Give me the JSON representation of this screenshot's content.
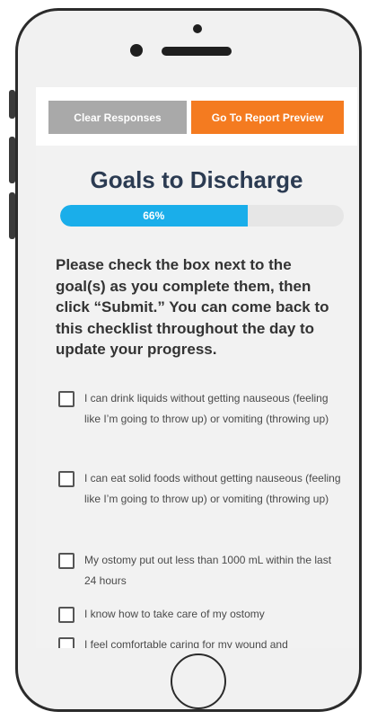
{
  "toolbar": {
    "clear_label": "Clear Responses",
    "report_label": "Go To Report Preview"
  },
  "page": {
    "title": "Goals to Discharge",
    "progress_text": "66%",
    "progress_fraction": 0.66,
    "instructions": "Please check the box next to the goal(s) as you complete them, then click “Submit.” You can come back to this checklist throughout the day to update your progress."
  },
  "goals": [
    {
      "label": "I can drink liquids without getting nauseous (feeling like I’m going to throw up) or vomiting (throwing up)",
      "checked": false
    },
    {
      "label": "I can eat solid foods without getting nauseous (feeling like I’m going to throw up) or vomiting (throwing up)",
      "checked": false
    },
    {
      "label": "My ostomy put out less than 1000 mL within the last 24 hours",
      "checked": false
    },
    {
      "label": "I know how to take care of my ostomy",
      "checked": false
    },
    {
      "label": "I feel comfortable caring for my wound and",
      "checked": false
    }
  ],
  "colors": {
    "clear_button": "#a9a9a9",
    "report_button": "#f47b20",
    "progress_fill": "#1aaeea",
    "title_text": "#2b3b52"
  }
}
